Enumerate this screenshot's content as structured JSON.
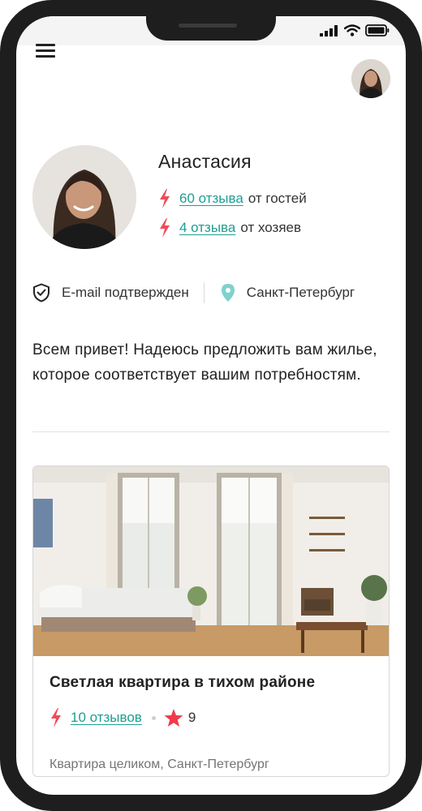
{
  "user": {
    "name": "Анастасия",
    "guest_reviews": {
      "link": "60 отзыва",
      "suffix": "от гостей"
    },
    "host_reviews": {
      "link": "4 отзыва",
      "suffix": "от хозяев"
    },
    "email_status": "E-mail подтвержден",
    "city": "Санкт-Петербург",
    "bio": "Всем привет! Надеюсь предложить вам жилье, которое соответствует вашим потребностям."
  },
  "listing": {
    "title": "Светлая квартира в тихом районе",
    "reviews_link": "10 отзывов",
    "rating": "9",
    "subtitle": "Квартира целиком, Санкт-Петербург"
  },
  "colors": {
    "accent_teal": "#1e9e93",
    "bolt_red": "#ef4b58",
    "star_red": "#ef3b4a",
    "pin_teal": "#7fd3cc",
    "frame": "#1e1e1e"
  },
  "icons": [
    "menu-icon",
    "shield-check-icon",
    "location-pin-icon",
    "lightning-icon",
    "star-icon",
    "signal-icon",
    "wifi-icon",
    "battery-icon"
  ]
}
